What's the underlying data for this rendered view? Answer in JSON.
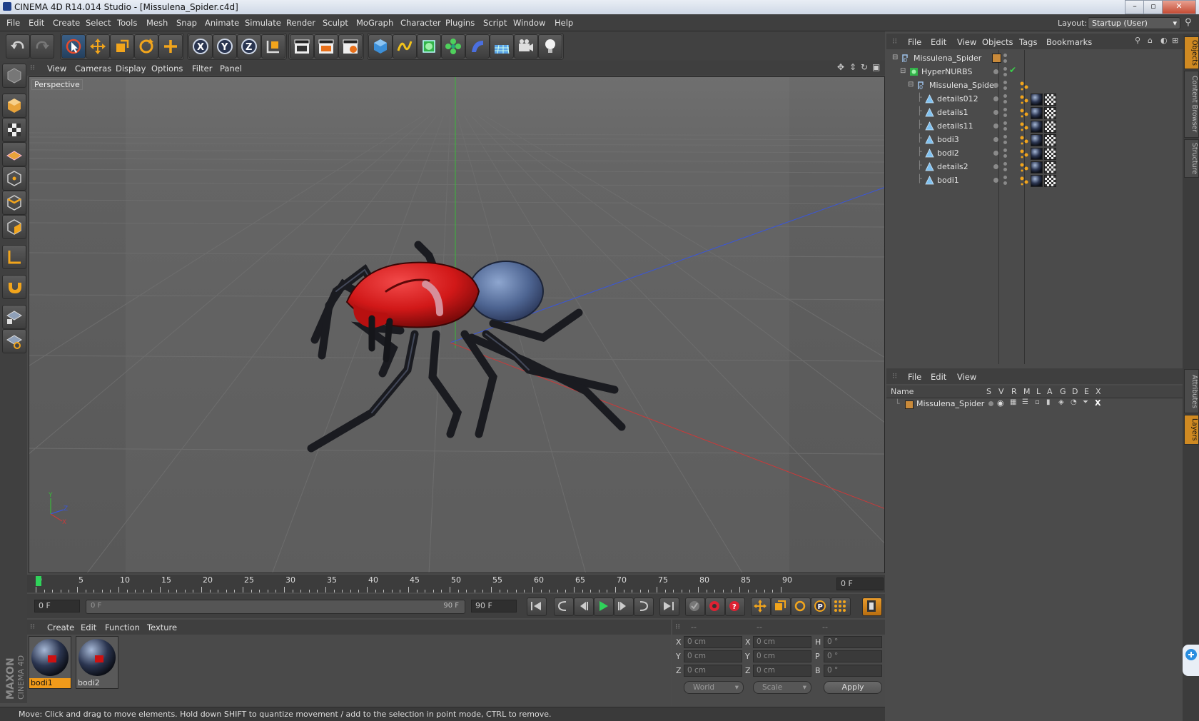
{
  "window": {
    "title": "CINEMA 4D R14.014 Studio - [Missulena_Spider.c4d]"
  },
  "menubar": [
    "File",
    "Edit",
    "Create",
    "Select",
    "Tools",
    "Mesh",
    "Snap",
    "Animate",
    "Simulate",
    "Render",
    "Sculpt",
    "MoGraph",
    "Character",
    "Plugins",
    "Script",
    "Window",
    "Help"
  ],
  "layout": {
    "label": "Layout:",
    "value": "Startup (User)"
  },
  "toolbar": {
    "icons": [
      "undo-icon",
      "redo-icon",
      "live-selection-icon",
      "move-icon",
      "scale-icon",
      "rotate-icon",
      "add-icon",
      "x-axis-icon",
      "y-axis-icon",
      "z-axis-icon",
      "coordinate-system-icon",
      "render-view-icon",
      "render-picture-viewer-icon",
      "edit-render-settings-icon",
      "cube-icon",
      "spline-pen-icon",
      "subdivision-icon",
      "array-icon",
      "deformer-icon",
      "floor-icon",
      "camera-icon",
      "light-icon"
    ]
  },
  "viewport": {
    "menu": [
      "View",
      "Cameras",
      "Display",
      "Options",
      "Filter",
      "Panel"
    ],
    "label": "Perspective"
  },
  "timeline": {
    "ticks": [
      "0",
      "5",
      "10",
      "15",
      "20",
      "25",
      "30",
      "35",
      "40",
      "45",
      "50",
      "55",
      "60",
      "65",
      "70",
      "75",
      "80",
      "85",
      "90"
    ],
    "current_frame_field": "0 F",
    "start_field": "0 F",
    "slider_start": "0 F",
    "slider_end": "90 F",
    "end_field": "90 F"
  },
  "materials": {
    "menu": [
      "Create",
      "Edit",
      "Function",
      "Texture"
    ],
    "items": [
      {
        "name": "bodi1",
        "selected": true
      },
      {
        "name": "bodi2",
        "selected": false
      }
    ]
  },
  "coordinates": {
    "headers": [
      "--",
      "--",
      "--"
    ],
    "rows": [
      {
        "l1": "X",
        "v1": "0 cm",
        "l2": "X",
        "v2": "0 cm",
        "l3": "H",
        "v3": "0 °"
      },
      {
        "l1": "Y",
        "v1": "0 cm",
        "l2": "Y",
        "v2": "0 cm",
        "l3": "P",
        "v3": "0 °"
      },
      {
        "l1": "Z",
        "v1": "0 cm",
        "l2": "Z",
        "v2": "0 cm",
        "l3": "B",
        "v3": "0 °"
      }
    ],
    "world": "World",
    "scale": "Scale",
    "apply": "Apply"
  },
  "status": "Move: Click and drag to move elements. Hold down SHIFT to quantize movement / add to the selection in point mode, CTRL to remove.",
  "branding": {
    "line1": "MAXON",
    "line2": "CINEMA 4D"
  },
  "object_manager": {
    "menu": [
      "File",
      "Edit",
      "View",
      "Objects",
      "Tags",
      "Bookmarks"
    ],
    "objects": [
      {
        "name": "Missulena_Spider",
        "depth": 0,
        "type": "null"
      },
      {
        "name": "HyperNURBS",
        "depth": 1,
        "type": "nurbs"
      },
      {
        "name": "Missulena_Spider",
        "depth": 2,
        "type": "null"
      },
      {
        "name": "details012",
        "depth": 3,
        "type": "mesh"
      },
      {
        "name": "details1",
        "depth": 3,
        "type": "mesh"
      },
      {
        "name": "details11",
        "depth": 3,
        "type": "mesh"
      },
      {
        "name": "bodi3",
        "depth": 3,
        "type": "mesh"
      },
      {
        "name": "bodi2",
        "depth": 3,
        "type": "mesh"
      },
      {
        "name": "details2",
        "depth": 3,
        "type": "mesh"
      },
      {
        "name": "bodi1",
        "depth": 3,
        "type": "mesh"
      }
    ]
  },
  "layer_manager": {
    "menu": [
      "File",
      "Edit",
      "View"
    ],
    "columns": [
      "Name",
      "S",
      "V",
      "R",
      "M",
      "L",
      "A",
      "G",
      "D",
      "E",
      "X"
    ],
    "layers": [
      {
        "name": "Missulena_Spider",
        "color": "#c98a3a"
      }
    ]
  },
  "right_tabs": [
    "Objects",
    "Content Browser",
    "Structure",
    "Attributes",
    "Layers"
  ],
  "colors": {
    "accent": "#f09a1a",
    "playhead": "#2fd35a",
    "x_axis": "#c83a3a",
    "y_axis": "#3ab83a",
    "z_axis": "#3a56d8"
  }
}
